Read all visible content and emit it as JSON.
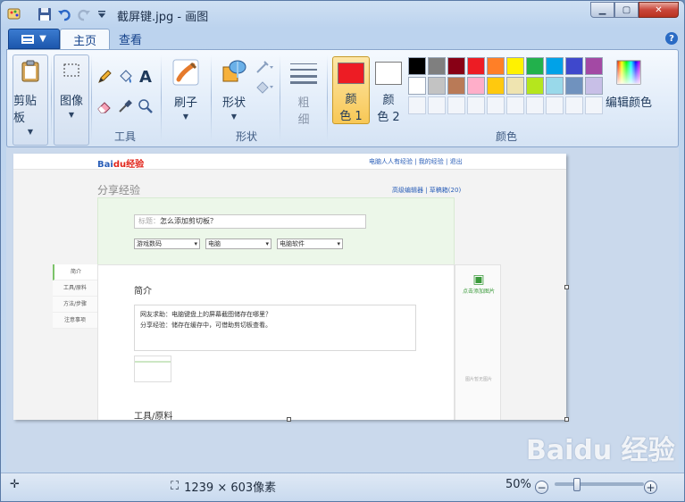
{
  "window": {
    "title": "截屏键.jpg - 画图",
    "buttons": {
      "minimize": "▁",
      "maximize": "▢",
      "close": "✕"
    }
  },
  "tabs": [
    {
      "label": "主页",
      "active": true
    },
    {
      "label": "查看",
      "active": false
    }
  ],
  "help_label": "?",
  "ribbon": {
    "clipboard": {
      "label": "剪贴板"
    },
    "image": {
      "label": "图像"
    },
    "tools": {
      "label": "工具"
    },
    "brushes": {
      "label": "刷子"
    },
    "shapes": {
      "label": "形状",
      "group_label": "形状"
    },
    "size": {
      "label_top": "粗",
      "label_bottom": "细"
    },
    "color1": {
      "label_top": "颜",
      "label_bottom": "色 1",
      "value": "#ed1c24"
    },
    "color2": {
      "label_top": "颜",
      "label_bottom": "色 2",
      "value": "#ffffff"
    },
    "colors_group_label": "颜色",
    "edit_colors": {
      "label": "编辑颜色"
    }
  },
  "palette": [
    "#000000",
    "#7f7f7f",
    "#880015",
    "#ed1c24",
    "#ff7f27",
    "#fff200",
    "#22b14c",
    "#00a2e8",
    "#3f48cc",
    "#a349a4",
    "#ffffff",
    "#c3c3c3",
    "#b97a57",
    "#ffaec9",
    "#ffc90e",
    "#efe4b0",
    "#b5e61d",
    "#99d9ea",
    "#7092be",
    "#c8bfe7"
  ],
  "page": {
    "logo_bai": "Bai",
    "logo_du": "du",
    "logo_jingyan": "经验",
    "top_links": "电脑人人有经验 | 我的经验 | 退出",
    "share_title": "分享经验",
    "right_links": "高级编辑器 | 草稿箱(20)",
    "title_placeholder": "标题：",
    "title_value": "怎么添加剪切板？",
    "selects": [
      "游戏数码",
      "电脑",
      "电脑软件"
    ],
    "side_items": [
      "简介",
      "工具/原料",
      "方法/步骤",
      "注意事项"
    ],
    "intro_heading": "简介",
    "qa_line1": "网友求助：电脑键盘上的屏幕截图储存在哪里？",
    "qa_line2": "分享经验：储存在缓存中，可借助剪切板查看。",
    "tools_heading": "工具/原料",
    "add_image": "点击添加图片",
    "no_image": "图片暂无图片"
  },
  "status": {
    "dimensions": "1239 × 603像素",
    "zoom": "50%",
    "zoom_level_percent": 50
  },
  "watermark": "Baidu 经验"
}
